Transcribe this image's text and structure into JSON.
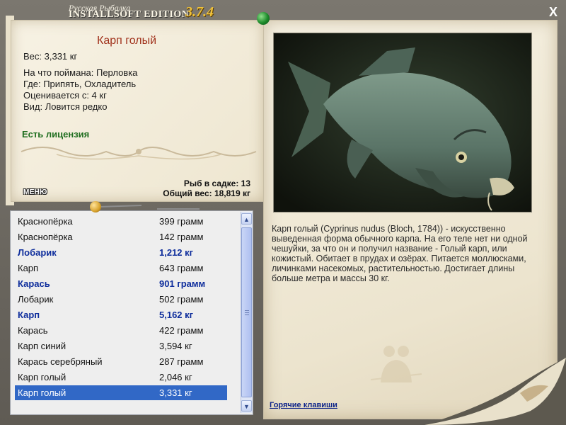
{
  "app": {
    "title_line1": "Русская Рыбалка",
    "title_line2": "INSTALLSOFT EDITION",
    "version": "3.7.4",
    "close_label": "X"
  },
  "catch": {
    "name": "Карп голый",
    "weight": "Вес: 3,331 кг",
    "bait": "На что поймана: Перловка",
    "place": "Где: Припять, Охладитель",
    "value": "Оценивается с: 4 кг",
    "rarity": "Вид: Ловится редко",
    "license": "Есть лицензия"
  },
  "stats": {
    "fish_count": "Рыб в садке: 13",
    "total_weight": "Общий вес: 18,819 кг"
  },
  "menu_label": "МЕНЮ",
  "fish_list": [
    {
      "name": "Краснопёрка",
      "weight": "399 грамм",
      "bold": false
    },
    {
      "name": "Краснопёрка",
      "weight": "142 грамм",
      "bold": false
    },
    {
      "name": "Лобарик",
      "weight": "1,212 кг",
      "bold": true
    },
    {
      "name": "Карп",
      "weight": "643 грамм",
      "bold": false
    },
    {
      "name": "Карась",
      "weight": "901 грамм",
      "bold": true
    },
    {
      "name": "Лобарик",
      "weight": "502 грамм",
      "bold": false
    },
    {
      "name": "Карп",
      "weight": "5,162 кг",
      "bold": true
    },
    {
      "name": "Карась",
      "weight": "422 грамм",
      "bold": false
    },
    {
      "name": "Карп синий",
      "weight": "3,594 кг",
      "bold": false
    },
    {
      "name": "Карась серебряный",
      "weight": "287 грамм",
      "bold": false
    },
    {
      "name": "Карп голый",
      "weight": "2,046 кг",
      "bold": false
    },
    {
      "name": "Карп голый",
      "weight": "3,331 кг",
      "bold": false,
      "selected": true
    }
  ],
  "description": "Карп голый (Cyprinus nudus (Bloch, 1784)) - искусственно выведенная форма обычного карпа. На его теле нет ни одной чешуйки, за что он и получил название - Голый карп, или кожистый. Обитает в прудах и озёрах. Питается моллюсками, личинками насекомых, растительностью. Достигает длины больше метра и массы 30 кг.",
  "hotkeys_label": "Горячие клавиши",
  "icons": {
    "close": "close-icon",
    "pin": "pin-icon",
    "scroll_up": "scroll-up-arrow-icon",
    "scroll_down": "scroll-down-arrow-icon"
  },
  "colors": {
    "fish_name": "#a0311b",
    "license": "#1f6e1f",
    "bold_row": "#0e2d9c",
    "selection": "#3168c6",
    "link": "#10268a"
  }
}
